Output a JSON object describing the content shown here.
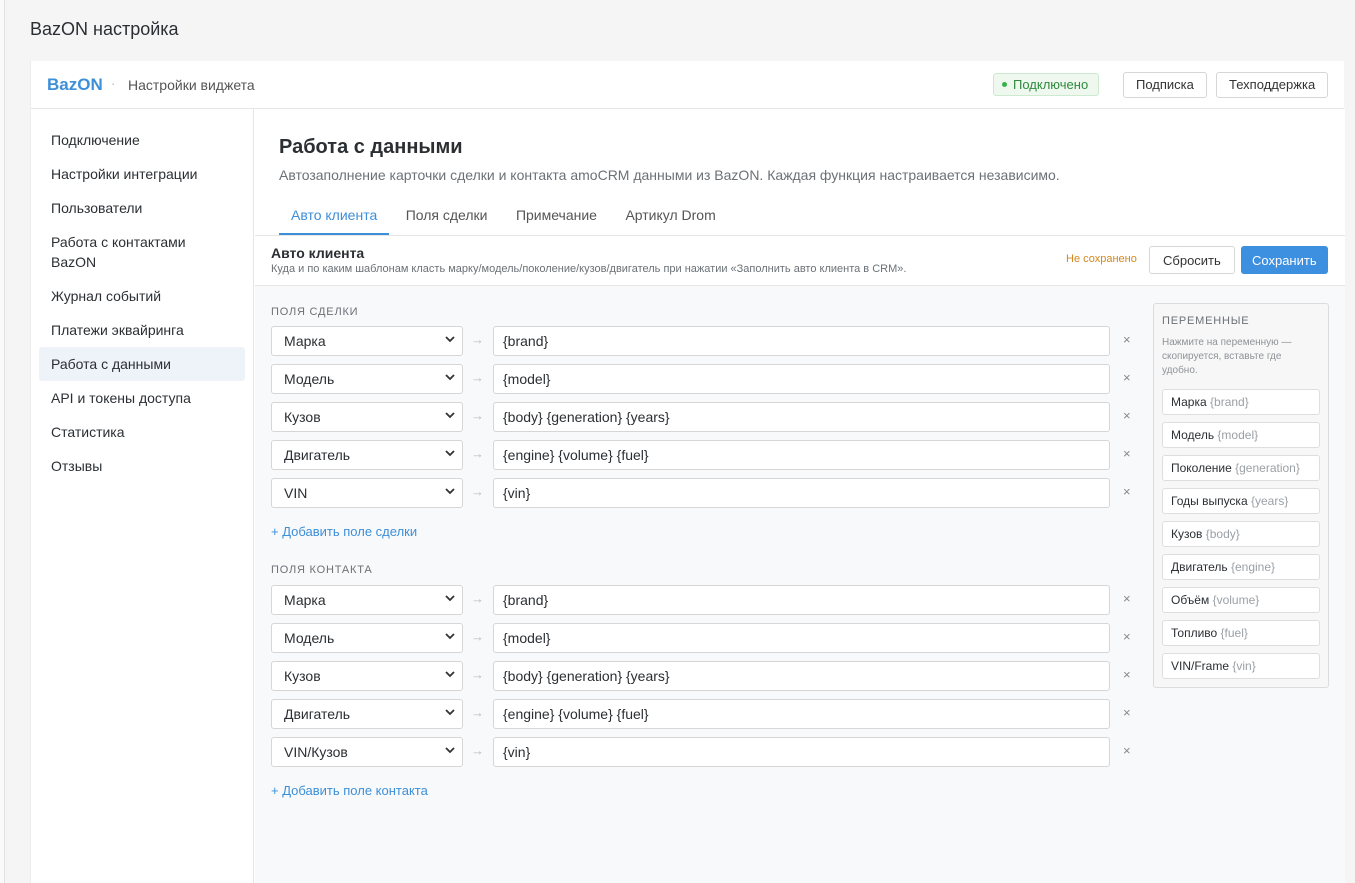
{
  "app": {
    "page_title": "BazON настройка"
  },
  "topbar": {
    "logo": "BazON",
    "separator": "·",
    "subtitle": "Настройки виджета",
    "status": "Подключено",
    "subscription_label": "Подписка",
    "support_label": "Техподдержка"
  },
  "sidebar": {
    "items": [
      {
        "label": "Подключение"
      },
      {
        "label": "Настройки интеграции"
      },
      {
        "label": "Пользователи"
      },
      {
        "label": "Работа с контактами BazON"
      },
      {
        "label": "Журнал событий"
      },
      {
        "label": "Платежи эквайринга"
      },
      {
        "label": "Работа с данными",
        "active": true
      },
      {
        "label": "API и токены доступа"
      },
      {
        "label": "Статистика"
      },
      {
        "label": "Отзывы"
      }
    ]
  },
  "main": {
    "title": "Работа с данными",
    "subtitle": "Автозаполнение карточки сделки и контакта amoCRM данными из BazON. Каждая функция настраивается независимо.",
    "tabs": [
      {
        "label": "Авто клиента",
        "active": true
      },
      {
        "label": "Поля сделки"
      },
      {
        "label": "Примечание"
      },
      {
        "label": "Артикул Drom"
      }
    ]
  },
  "section": {
    "title": "Авто клиента",
    "description": "Куда и по каким шаблонам класть марку/модель/поколение/кузов/двигатель при нажатии «Заполнить авто клиента в CRM».",
    "unsaved_label": "Не сохранено",
    "reset_label": "Сбросить",
    "save_label": "Сохранить"
  },
  "deal_fields": {
    "label": "ПОЛЯ СДЕЛКИ",
    "rows": [
      {
        "field": "Марка",
        "template": "{brand}"
      },
      {
        "field": "Модель",
        "template": "{model}"
      },
      {
        "field": "Кузов",
        "template": "{body} {generation} {years}"
      },
      {
        "field": "Двигатель",
        "template": "{engine} {volume} {fuel}"
      },
      {
        "field": "VIN",
        "template": "{vin}"
      }
    ],
    "add_label": "+ Добавить поле сделки"
  },
  "contact_fields": {
    "label": "ПОЛЯ КОНТАКТА",
    "rows": [
      {
        "field": "Марка",
        "template": "{brand}"
      },
      {
        "field": "Модель",
        "template": "{model}"
      },
      {
        "field": "Кузов",
        "template": "{body} {generation} {years}"
      },
      {
        "field": "Двигатель",
        "template": "{engine} {volume} {fuel}"
      },
      {
        "field": "VIN/Кузов",
        "template": "{vin}"
      }
    ],
    "add_label": "+ Добавить поле контакта"
  },
  "row_arrow": "→",
  "row_remove": "×",
  "variables": {
    "title": "ПЕРЕМЕННЫЕ",
    "hint": "Нажмите на переменную — скопируется, вставьте где удобно.",
    "items": [
      {
        "name": "Марка",
        "code": "{brand}"
      },
      {
        "name": "Модель",
        "code": "{model}"
      },
      {
        "name": "Поколение",
        "code": "{generation}"
      },
      {
        "name": "Годы выпуска",
        "code": "{years}"
      },
      {
        "name": "Кузов",
        "code": "{body}"
      },
      {
        "name": "Двигатель",
        "code": "{engine}"
      },
      {
        "name": "Объём",
        "code": "{volume}"
      },
      {
        "name": "Топливо",
        "code": "{fuel}"
      },
      {
        "name": "VIN/Frame",
        "code": "{vin}"
      }
    ]
  },
  "colors": {
    "accent": "#3d8fd8",
    "success": "#2e8b3c",
    "warning": "#d4881e"
  }
}
